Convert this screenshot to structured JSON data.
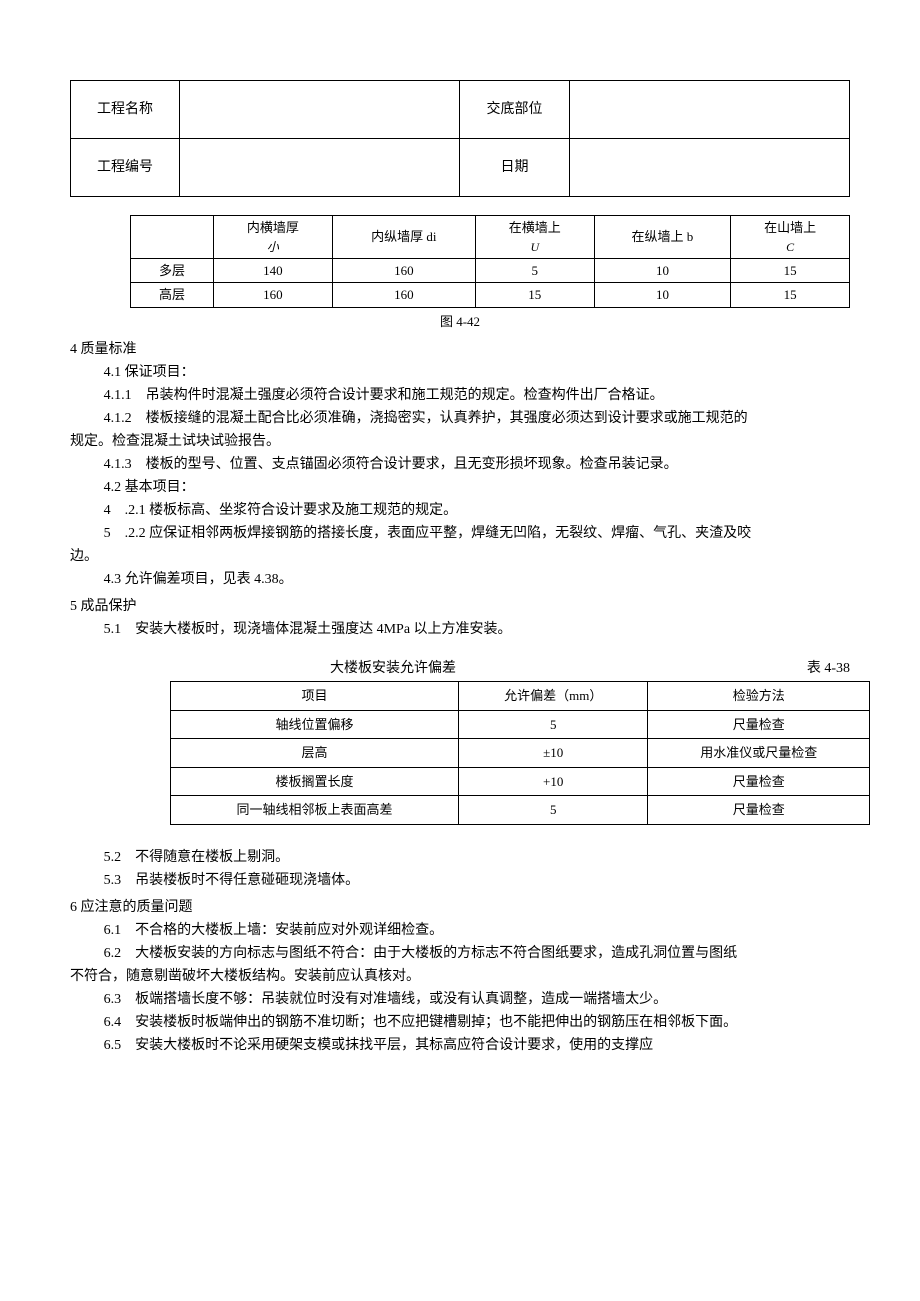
{
  "header": {
    "row1_label1": "工程名称",
    "row1_val1": "",
    "row1_label2": "交底部位",
    "row1_val2": "",
    "row2_label1": "工程编号",
    "row2_val1": "",
    "row2_label2": "日期",
    "row2_val2": ""
  },
  "table1": {
    "cols": {
      "blank": "",
      "c1_line1": "内横墙厚",
      "c1_line2": "小",
      "c2": "内纵墙厚 di",
      "c3_line1": "在横墙上",
      "c3_line2": "U",
      "c4": "在纵墙上 b",
      "c5_line1": "在山墙上",
      "c5_line2": "C"
    },
    "rows": [
      {
        "label": "多层",
        "v": [
          "140",
          "160",
          "5",
          "10",
          "15"
        ]
      },
      {
        "label": "高层",
        "v": [
          "160",
          "160",
          "15",
          "10",
          "15"
        ]
      }
    ],
    "caption": "图 4-42"
  },
  "sec4": {
    "title": "4 质量标准",
    "p41": "4.1 保证项目：",
    "p411": "4.1.1　吊装构件时混凝土强度必须符合设计要求和施工规范的规定。检查构件出厂合格证。",
    "p412a": "4.1.2　楼板接缝的混凝土配合比必须准确，浇捣密实，认真养护，其强度必须达到设计要求或施工规范的",
    "p412b": "规定。检查混凝土试块试验报告。",
    "p413": "4.1.3　楼板的型号、位置、支点锚固必须符合设计要求，且无变形损坏现象。检查吊装记录。",
    "p42": "4.2 基本项目：",
    "p421": "4　.2.1 楼板标高、坐浆符合设计要求及施工规范的规定。",
    "p422a": "5　.2.2 应保证相邻两板焊接钢筋的搭接长度，表面应平整，焊缝无凹陷，无裂纹、焊瘤、气孔、夹渣及咬",
    "p422b": "边。",
    "p43": "4.3 允许偏差项目，见表 4.38。"
  },
  "sec5": {
    "title": "5 成品保护",
    "p51": "5.1　安装大楼板时，现浇墙体混凝土强度达 4MPa 以上方准安装。",
    "p52": "5.2　不得随意在楼板上剔洞。",
    "p53": "5.3　吊装楼板时不得任意碰砸现浇墙体。"
  },
  "tolerance": {
    "title_left": "大楼板安装允许偏差",
    "title_right": "表 4-38",
    "head": [
      "项目",
      "允许偏差（mm）",
      "检验方法"
    ],
    "rows": [
      [
        "轴线位置偏移",
        "5",
        "尺量检查"
      ],
      [
        "层高",
        "±10",
        "用水准仪或尺量检查"
      ],
      [
        "楼板搁置长度",
        "+10",
        "尺量检查"
      ],
      [
        "同一轴线相邻板上表面高差",
        "5",
        "尺量检查"
      ]
    ]
  },
  "sec6": {
    "title": "6 应注意的质量问题",
    "p61": "6.1　不合格的大楼板上墙：安装前应对外观详细检查。",
    "p62a": "6.2　大楼板安装的方向标志与图纸不符合：由于大楼板的方标志不符合图纸要求，造成孔洞位置与图纸",
    "p62b": "不符合，随意剔凿破坏大楼板结构。安装前应认真核对。",
    "p63": "6.3　板端搭墙长度不够：吊装就位时没有对准墙线，或没有认真调整，造成一端搭墙太少。",
    "p64": "6.4　安装楼板时板端伸出的钢筋不准切断；也不应把键槽剔掉；也不能把伸出的钢筋压在相邻板下面。",
    "p65": "6.5　安装大楼板时不论采用硬架支模或抹找平层，其标高应符合设计要求，使用的支撑应"
  }
}
